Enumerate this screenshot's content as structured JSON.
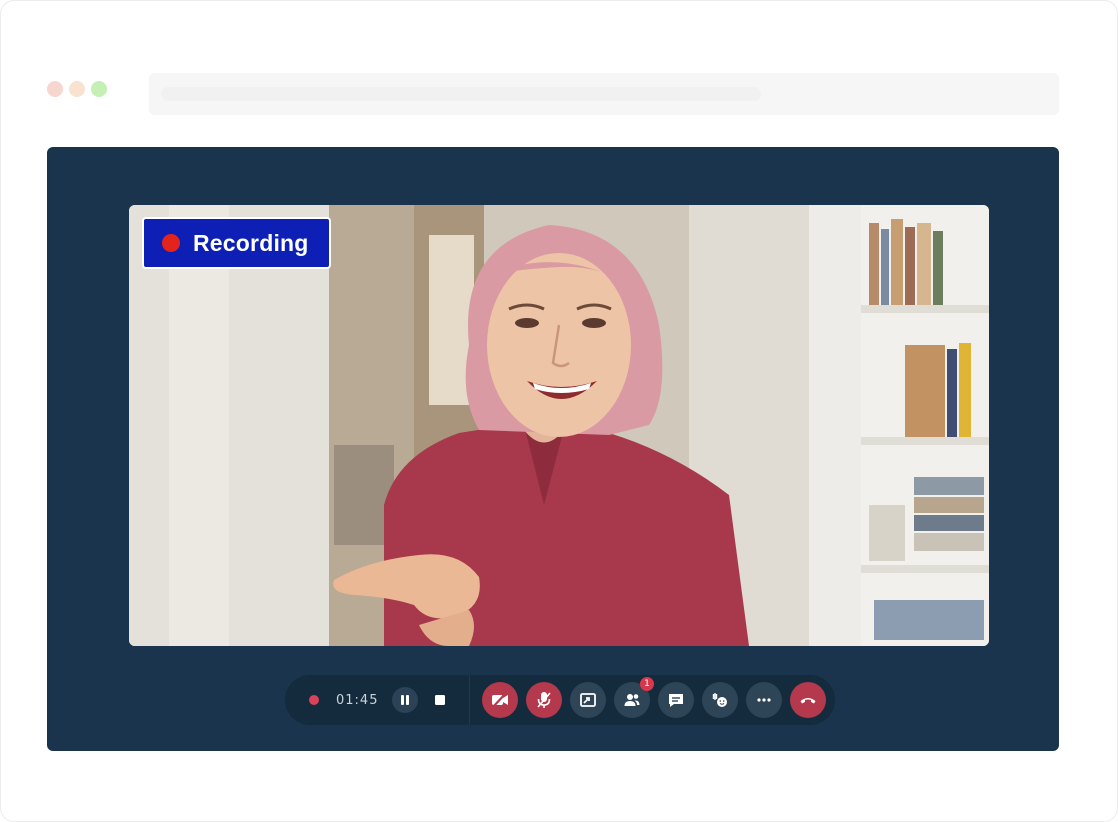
{
  "recording": {
    "label": "Recording"
  },
  "controls": {
    "timer": "01:45",
    "participants_badge": "1"
  },
  "icons": {
    "video_off": "video-off-icon",
    "mic_off": "mic-off-icon",
    "share_screen": "share-screen-icon",
    "participants": "participants-icon",
    "chat": "chat-icon",
    "reactions": "reactions-icon",
    "more": "more-icon",
    "hang_up": "hang-up-icon"
  },
  "colors": {
    "app_background": "#19344c",
    "recording_badge": "#0d1fb5",
    "recording_dot": "#e3241c",
    "active_red_button": "#b4394c"
  }
}
